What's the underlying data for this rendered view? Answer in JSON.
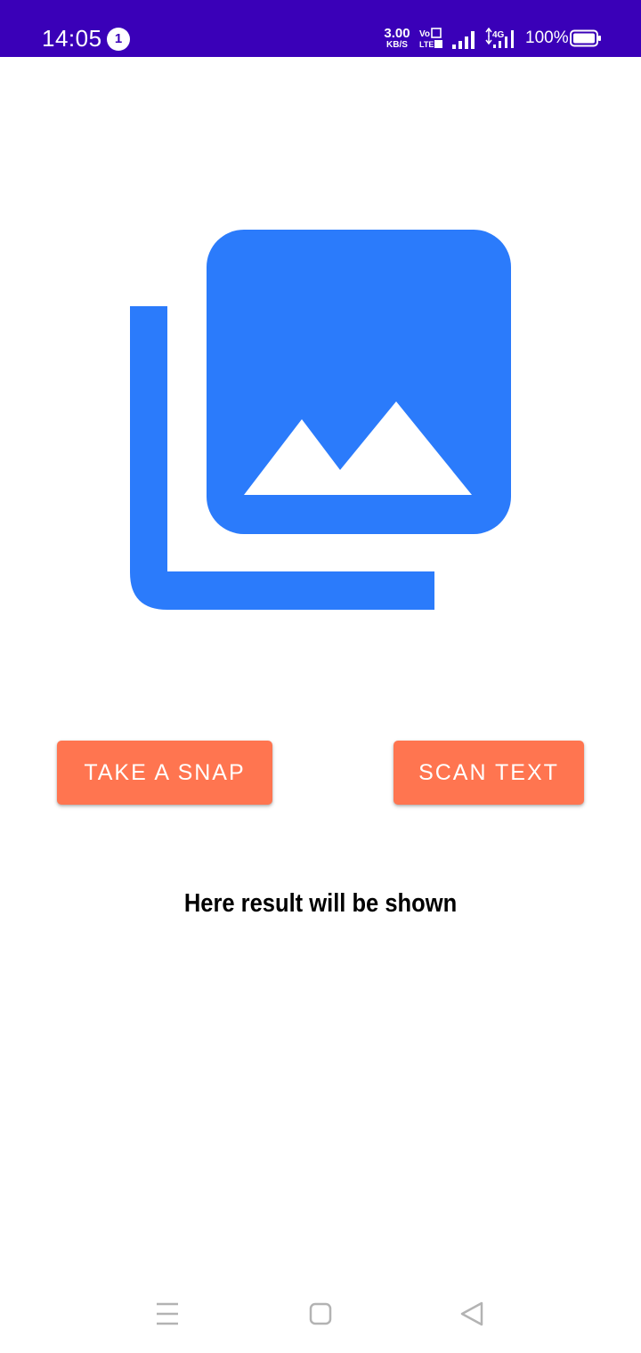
{
  "status_bar": {
    "time": "14:05",
    "notification_count": "1",
    "net_speed_value": "3.00",
    "net_speed_unit": "KB/S",
    "battery_percent": "100%",
    "background_color": "#3a00b8"
  },
  "main": {
    "hero_icon": "photo-library-icon",
    "hero_color": "#2b7bfb",
    "buttons": {
      "take_snap_label": "TAKE A SNAP",
      "scan_text_label": "SCAN TEXT",
      "color": "#ff7550"
    },
    "result_text": "Here result will be shown"
  },
  "nav_bar": {
    "menu_icon": "menu-icon",
    "home_icon": "home-square-icon",
    "back_icon": "back-triangle-icon"
  }
}
